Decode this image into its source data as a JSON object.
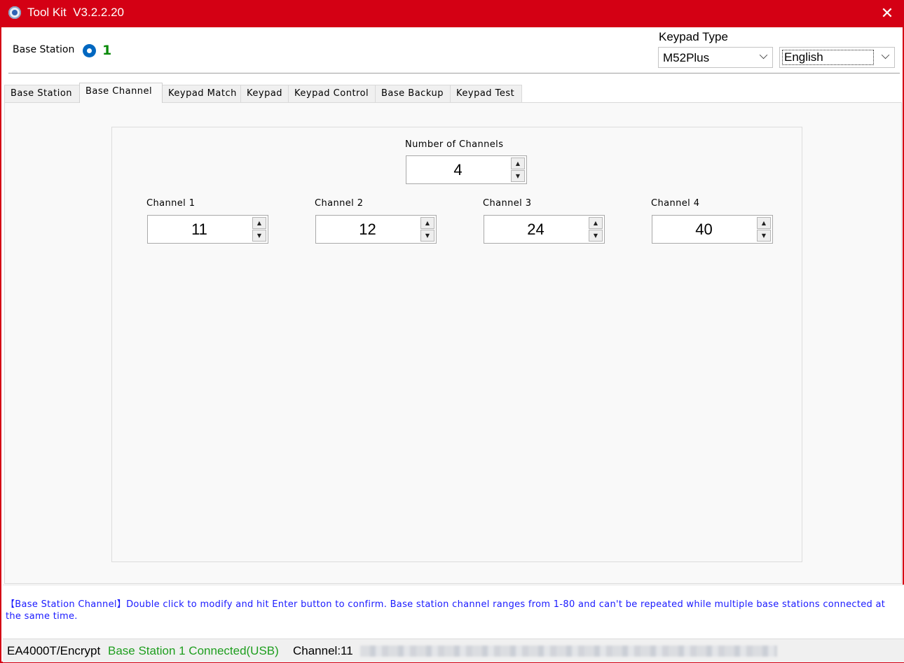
{
  "titlebar": {
    "title": "Tool Kit  V3.2.2.20",
    "close_symbol": "✕"
  },
  "header": {
    "base_station_label": "Base Station",
    "base_station_number": "1",
    "keypad_type_label": "Keypad Type",
    "keypad_type_value": "M52Plus",
    "language_value": "English"
  },
  "tabs": [
    {
      "label": "Base Station",
      "active": false
    },
    {
      "label": "Base Channel",
      "active": true
    },
    {
      "label": "Keypad Match",
      "active": false
    },
    {
      "label": "Keypad",
      "active": false
    },
    {
      "label": "Keypad Control",
      "active": false
    },
    {
      "label": "Base Backup",
      "active": false
    },
    {
      "label": "Keypad Test",
      "active": false
    }
  ],
  "channels": {
    "count_label": "Number of Channels",
    "count_value": "4",
    "items": [
      {
        "label": "Channel 1",
        "value": "11"
      },
      {
        "label": "Channel 2",
        "value": "12"
      },
      {
        "label": "Channel 3",
        "value": "24"
      },
      {
        "label": "Channel 4",
        "value": "40"
      }
    ]
  },
  "info_message": "【Base Station Channel】Double click to modify and hit Enter button to confirm. Base station channel ranges from 1-80 and can't be repeated while multiple base stations connected at the same time.",
  "statusbar": {
    "model": "EA4000T/Encrypt",
    "connection": "Base Station 1 Connected(USB)",
    "channel": "Channel:11"
  },
  "colors": {
    "titlebar": "#d40014",
    "connected_text": "#1e9e1e",
    "info_text": "#1a1aff",
    "station_number": "#0a8a0a",
    "radio_accent": "#0067c0"
  },
  "icons": {
    "app": "app-icon",
    "close": "close-icon",
    "dropdown": "chevron-down-icon",
    "spin_up": "arrow-up-icon",
    "spin_down": "arrow-down-icon"
  }
}
